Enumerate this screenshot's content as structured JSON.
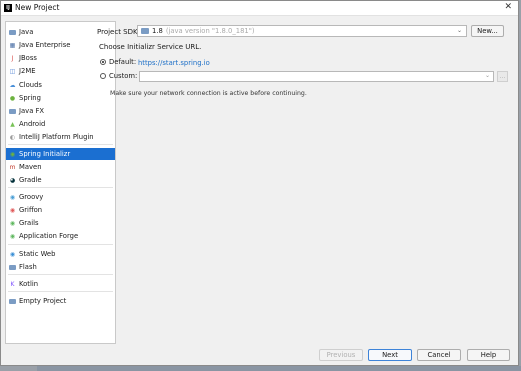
{
  "window": {
    "title": "New Project",
    "app_icon_text": "IJ",
    "close_glyph": "✕"
  },
  "sidebar": {
    "items": [
      {
        "label": "Java",
        "icon": "folder-icon",
        "color": "#7b9cc4"
      },
      {
        "label": "Java Enterprise",
        "icon": "java-enterprise-icon",
        "color": "#4a6fa5"
      },
      {
        "label": "JBoss",
        "icon": "jboss-icon",
        "color": "#d9534f"
      },
      {
        "label": "J2ME",
        "icon": "j2me-icon",
        "color": "#5b8bd6"
      },
      {
        "label": "Clouds",
        "icon": "cloud-icon",
        "color": "#4a90d9"
      },
      {
        "label": "Spring",
        "icon": "spring-leaf-icon",
        "color": "#6db33f"
      },
      {
        "label": "Java FX",
        "icon": "folder-icon",
        "color": "#7b9cc4"
      },
      {
        "label": "Android",
        "icon": "android-icon",
        "color": "#78c257"
      },
      {
        "label": "IntelliJ Platform Plugin",
        "icon": "plugin-icon",
        "color": "#9a9a9a"
      },
      {
        "label": "Spring Initializr",
        "icon": "spring-initializr-icon",
        "color": "#6db33f"
      },
      {
        "label": "Maven",
        "icon": "maven-icon",
        "color": "#c0392b"
      },
      {
        "label": "Gradle",
        "icon": "gradle-icon",
        "color": "#02303a"
      },
      {
        "label": "Groovy",
        "icon": "groovy-icon",
        "color": "#4a9fd6"
      },
      {
        "label": "Griffon",
        "icon": "griffon-icon",
        "color": "#e05a5a"
      },
      {
        "label": "Grails",
        "icon": "grails-icon",
        "color": "#5fb85f"
      },
      {
        "label": "Application Forge",
        "icon": "application-forge-icon",
        "color": "#5fb85f"
      },
      {
        "label": "Static Web",
        "icon": "globe-icon",
        "color": "#3a8fd6"
      },
      {
        "label": "Flash",
        "icon": "folder-icon",
        "color": "#7b9cc4"
      },
      {
        "label": "Kotlin",
        "icon": "kotlin-icon",
        "color": "#7f52ff"
      },
      {
        "label": "Empty Project",
        "icon": "folder-icon",
        "color": "#7b9cc4"
      }
    ],
    "selected_index": 9
  },
  "sdk": {
    "label": "Project SDK:",
    "selected_name": "1.8",
    "selected_version": "(java version \"1.8.0_181\")",
    "new_button": "New..."
  },
  "initializr": {
    "heading": "Choose Initializr Service URL.",
    "default_label": "Default:",
    "default_url": "https://start.spring.io",
    "custom_label": "Custom:",
    "custom_value": "",
    "note": "Make sure your network connection is active before continuing.",
    "selected_option": "default"
  },
  "footer": {
    "previous": "Previous",
    "next": "Next",
    "cancel": "Cancel",
    "help": "Help"
  },
  "colors": {
    "selection": "#1b6fd1",
    "link": "#1d6fc7"
  }
}
